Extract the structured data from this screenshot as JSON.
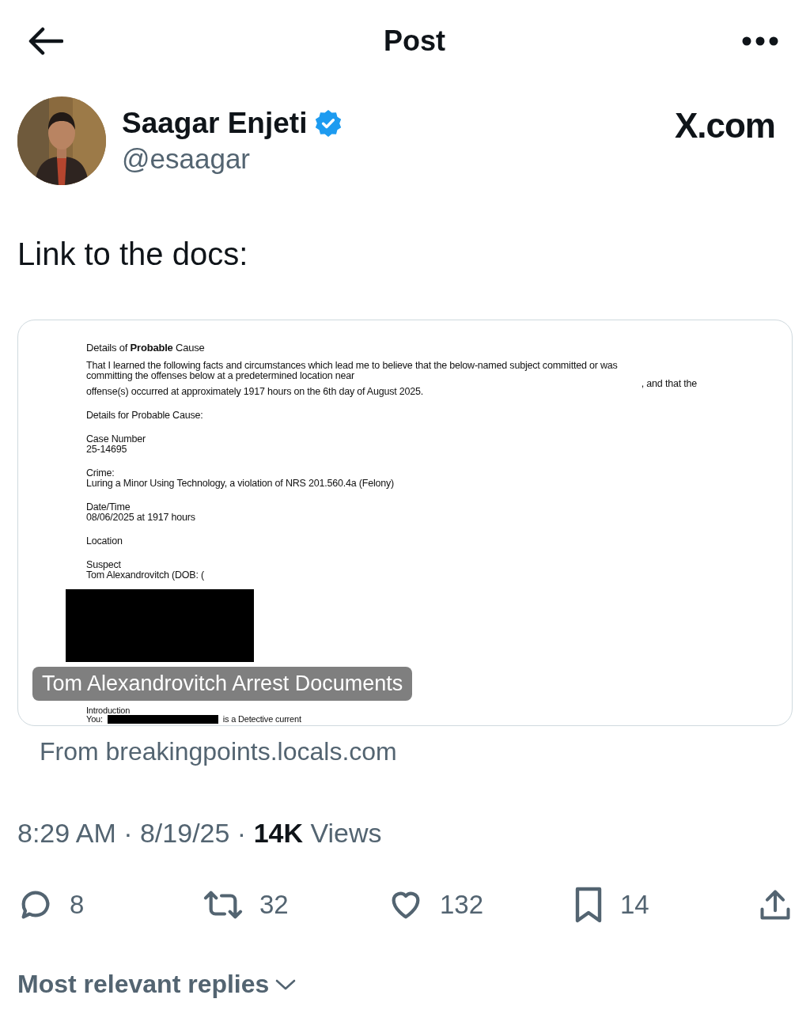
{
  "header": {
    "title": "Post"
  },
  "author": {
    "name": "Saagar Enjeti",
    "verified": true,
    "handle": "@esaagar"
  },
  "source_logo": "X.com",
  "text": "Link to the docs:",
  "link_card": {
    "caption": "Tom Alexandrovitch Arrest Documents",
    "document": {
      "title": "Details of **Probable** Cause",
      "blocks": [
        {
          "kind": "text",
          "lines": [
            {
              "text": "That I learned the following facts and circumstances which lead me to believe that the below-named subject committed or was"
            },
            {
              "text": "committing the offenses below at a predetermined location near"
            },
            {
              "text": ", and that the",
              "kind": "aside"
            },
            {
              "text": "offense(s) occurred at approximately 1917 hours on the 6th day of August 2025."
            }
          ]
        },
        {
          "kind": "text",
          "lines": [
            {
              "text": "Details for Probable Cause:"
            }
          ]
        },
        {
          "kind": "text",
          "lines": [
            {
              "text": "Case Number"
            },
            {
              "text": "25-14695"
            }
          ]
        },
        {
          "kind": "text",
          "lines": [
            {
              "text": "Crime:"
            },
            {
              "text": "Luring a Minor Using Technology, a violation of NRS 201.560.4a (Felony)"
            }
          ]
        },
        {
          "kind": "text",
          "lines": [
            {
              "text": "Date/Time"
            },
            {
              "text": "08/06/2025 at 1917 hours"
            }
          ]
        },
        {
          "kind": "text",
          "lines": [
            {
              "text": "Location"
            }
          ]
        },
        {
          "kind": "text",
          "lines": [
            {
              "text": "Suspect"
            },
            {
              "text": "Tom Alexandrovitch (DOB: ("
            }
          ]
        },
        {
          "kind": "redaction"
        },
        {
          "kind": "text",
          "lines": [
            {
              "text": "Introduction"
            }
          ]
        },
        {
          "kind": "redacted_line",
          "before": "You:",
          "after": "is a Detective current"
        }
      ]
    },
    "domain": "From breakingpoints.locals.com"
  },
  "meta": "8:29 AM · 8/19/25 · **14K** Views",
  "actions": [
    {
      "kind": "reply",
      "count": "8"
    },
    {
      "kind": "repost",
      "count": "32"
    },
    {
      "kind": "like",
      "count": "132"
    },
    {
      "kind": "bookmark",
      "count": "14"
    },
    {
      "kind": "share"
    }
  ],
  "replies_filter": {
    "label": "Most relevant replies"
  }
}
